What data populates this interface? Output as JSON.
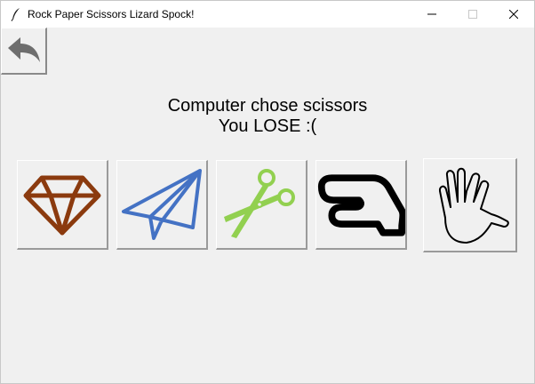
{
  "window": {
    "title": "Rock Paper Scissors Lizard Spock!",
    "app_icon": "feather-icon",
    "controls": {
      "minimize_icon": "minimize-icon",
      "maximize_icon": "maximize-icon",
      "close_icon": "close-icon"
    }
  },
  "toolbar": {
    "back_icon": "back-arrow-icon"
  },
  "result": {
    "computer_choice": "Computer chose scissors",
    "outcome": "You LOSE :("
  },
  "choices": [
    {
      "name": "rock",
      "icon": "diamond-icon",
      "color": "#8b3a0e"
    },
    {
      "name": "paper",
      "icon": "paper-plane-icon",
      "color": "#4472c4"
    },
    {
      "name": "scissors",
      "icon": "scissors-icon",
      "color": "#92d050"
    },
    {
      "name": "lizard",
      "icon": "lizard-hand-icon",
      "color": "#000000"
    },
    {
      "name": "spock",
      "icon": "vulcan-salute-icon",
      "color": "#000000"
    }
  ],
  "colors": {
    "background": "#f0f0f0",
    "titlebar": "#ffffff",
    "back_arrow": "#6e6e6e"
  }
}
